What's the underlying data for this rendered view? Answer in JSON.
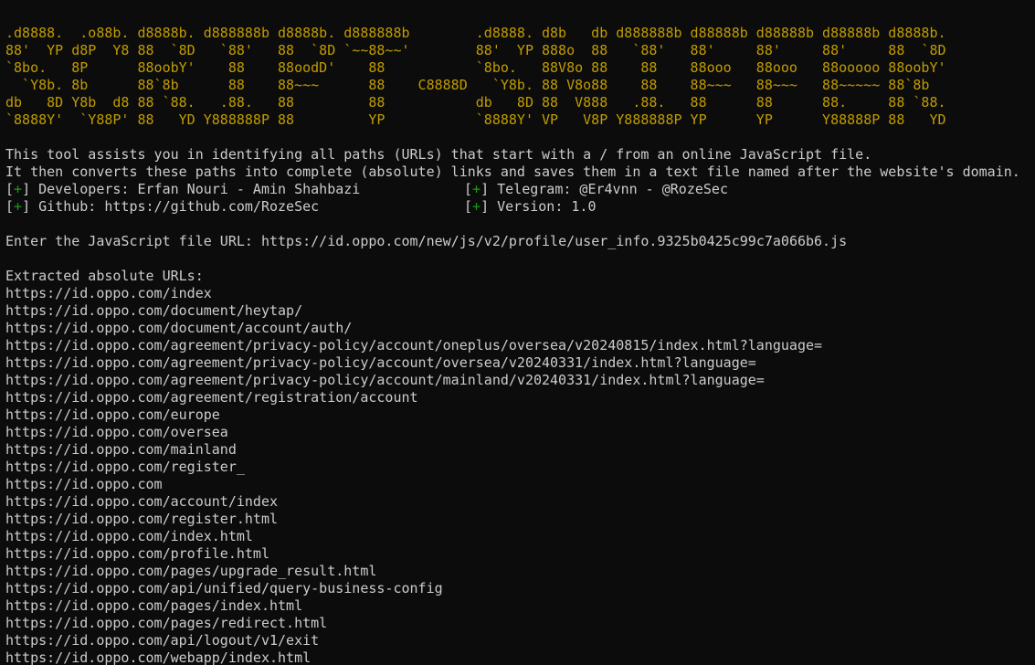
{
  "banner": {
    "lines": [
      ".d8888.  .o88b. d8888b. d888888b d8888b. d888888b        .d8888. d8b   db d888888b d88888b d88888b d88888b d8888b.",
      "88'  YP d8P  Y8 88  `8D   `88'   88  `8D `~~88~~'        88'  YP 888o  88   `88'   88'     88'     88'     88  `8D",
      "`8bo.   8P      88oobY'    88    88oodD'    88           `8bo.   88V8o 88    88    88ooo   88ooo   88ooooo 88oobY'",
      "  `Y8b. 8b      88`8b      88    88~~~      88    C8888D   `Y8b. 88 V8o88    88    88~~~   88~~~   88~~~~~ 88`8b",
      "db   8D Y8b  d8 88 `88.   .88.   88         88           db   8D 88  V888   .88.   88      88      88.     88 `88.",
      "`8888Y'  `Y88P' 88   YD Y888888P 88         YP           `8888Y' VP   V8P Y888888P YP      YP      Y88888P 88   YD"
    ]
  },
  "description": {
    "line1": "This tool assists you in identifying all paths (URLs) that start with a / from an online JavaScript file.",
    "line2": "It then converts these paths into complete (absolute) links and saves them in a text file named after the website's domain."
  },
  "info": {
    "bracket_open": "[",
    "plus": "+",
    "bracket_close": "]",
    "developers": " Developers: Erfan Nouri - Amin Shahbazi",
    "telegram": " Telegram: @Er4vnn - @RozeSec",
    "github": " Github: https://github.com/RozeSec",
    "version": " Version: 1.0"
  },
  "prompt": {
    "label": "Enter the JavaScript file URL: ",
    "value": "https://id.oppo.com/new/js/v2/profile/user_info.9325b0425c99c7a066b6.js"
  },
  "results": {
    "header": "Extracted absolute URLs:",
    "urls": [
      "https://id.oppo.com/index",
      "https://id.oppo.com/document/heytap/",
      "https://id.oppo.com/document/account/auth/",
      "https://id.oppo.com/agreement/privacy-policy/account/oneplus/oversea/v20240815/index.html?language=",
      "https://id.oppo.com/agreement/privacy-policy/account/oversea/v20240331/index.html?language=",
      "https://id.oppo.com/agreement/privacy-policy/account/mainland/v20240331/index.html?language=",
      "https://id.oppo.com/agreement/registration/account",
      "https://id.oppo.com/europe",
      "https://id.oppo.com/oversea",
      "https://id.oppo.com/mainland",
      "https://id.oppo.com/register_",
      "https://id.oppo.com",
      "https://id.oppo.com/account/index",
      "https://id.oppo.com/register.html",
      "https://id.oppo.com/index.html",
      "https://id.oppo.com/profile.html",
      "https://id.oppo.com/pages/upgrade_result.html",
      "https://id.oppo.com/api/unified/query-business-config",
      "https://id.oppo.com/pages/index.html",
      "https://id.oppo.com/pages/redirect.html",
      "https://id.oppo.com/api/logout/v1/exit",
      "https://id.oppo.com/webapp/index.html"
    ]
  },
  "colors": {
    "background": "#0c0c0c",
    "foreground": "#cccccc",
    "banner": "#c19c00",
    "plus": "#13a10e"
  }
}
